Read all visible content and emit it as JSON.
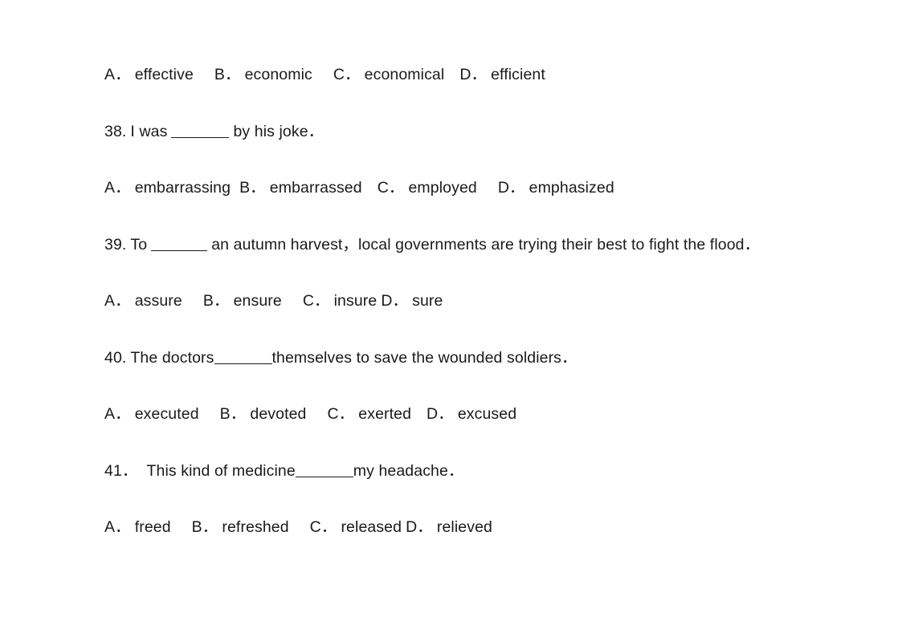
{
  "document": {
    "type": "multiple-choice-exercise-worksheet",
    "background_color": "#ffffff",
    "text_color": "#1a1a1a"
  },
  "blocks": [
    {
      "id": "options-37",
      "kind": "options",
      "options": [
        {
          "letter": "A．",
          "text": "effective"
        },
        {
          "letter": "B．",
          "text": "economic"
        },
        {
          "letter": "C．",
          "text": "economical"
        },
        {
          "letter": "D．",
          "text": "efficient"
        }
      ]
    },
    {
      "id": "question-38",
      "kind": "question",
      "number": "38.",
      "text_before": "I was",
      "text_after": "by his joke．"
    },
    {
      "id": "options-38",
      "kind": "options",
      "options": [
        {
          "letter": "A．",
          "text": "embarrassing"
        },
        {
          "letter": "B．",
          "text": "embarrassed"
        },
        {
          "letter": "C．",
          "text": "employed"
        },
        {
          "letter": "D．",
          "text": "emphasized"
        }
      ]
    },
    {
      "id": "question-39",
      "kind": "question",
      "number": "39.",
      "text_before": "To",
      "text_after": "an autumn harvest，local governments are trying their best to fight the flood．"
    },
    {
      "id": "options-39",
      "kind": "options",
      "options": [
        {
          "letter": "A．",
          "text": "assure"
        },
        {
          "letter": "B．",
          "text": "ensure"
        },
        {
          "letter": "C．",
          "text": "insure"
        },
        {
          "letter": "D．",
          "text": "sure"
        }
      ]
    },
    {
      "id": "question-40",
      "kind": "question",
      "number": "40.",
      "text_before": "The doctors",
      "text_after": "themselves to save the wounded soldiers．"
    },
    {
      "id": "options-40",
      "kind": "options",
      "options": [
        {
          "letter": "A．",
          "text": "executed"
        },
        {
          "letter": "B．",
          "text": "devoted"
        },
        {
          "letter": "C．",
          "text": "exerted"
        },
        {
          "letter": "D．",
          "text": "excused"
        }
      ]
    },
    {
      "id": "question-41",
      "kind": "question",
      "number": "41．",
      "text_before": "This kind of medicine",
      "text_after": "my headache．"
    },
    {
      "id": "options-41",
      "kind": "options",
      "options": [
        {
          "letter": "A．",
          "text": "freed"
        },
        {
          "letter": "B．",
          "text": "refreshed"
        },
        {
          "letter": "C．",
          "text": "released"
        },
        {
          "letter": "D．",
          "text": "relieved"
        }
      ]
    }
  ]
}
